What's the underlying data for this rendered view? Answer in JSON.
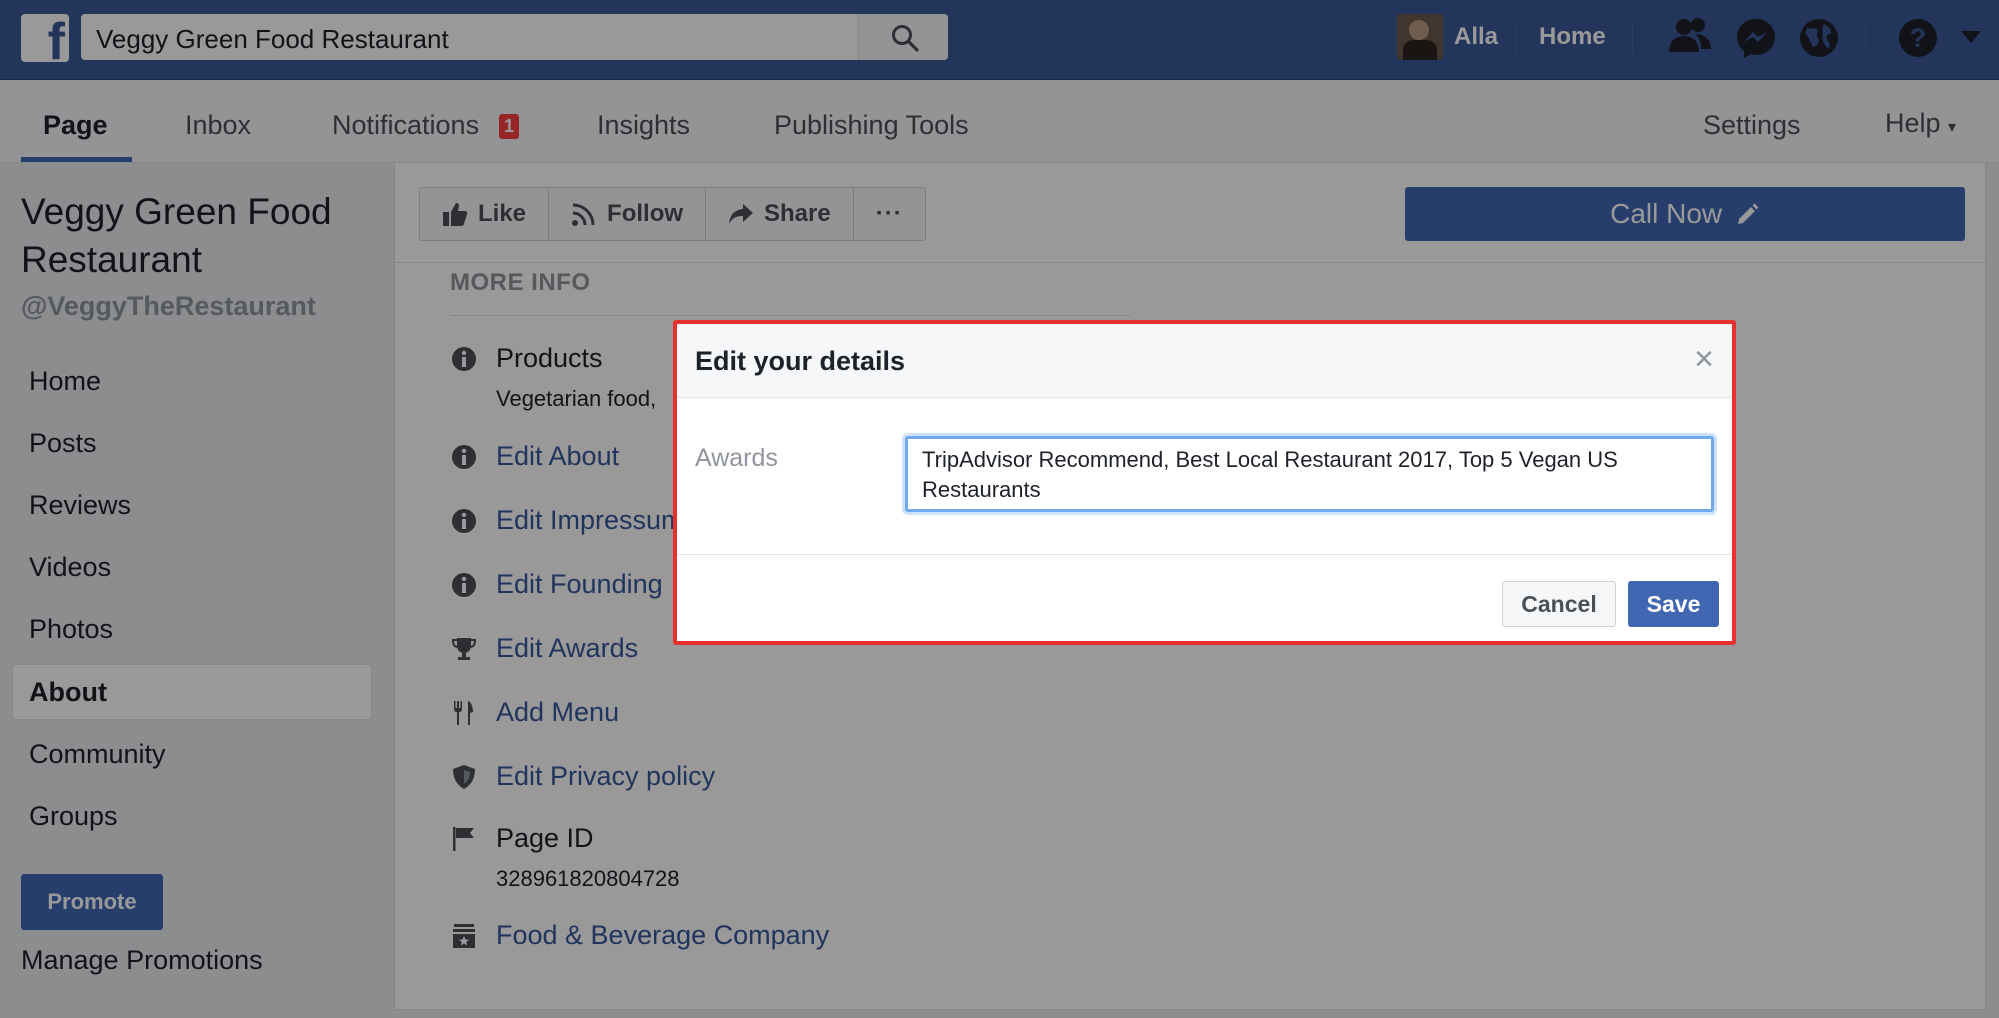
{
  "topbar": {
    "search_value": "Veggy Green Food Restaurant",
    "user_name": "Alla",
    "home_label": "Home"
  },
  "page_nav": {
    "tabs": [
      {
        "label": "Page"
      },
      {
        "label": "Inbox"
      },
      {
        "label": "Notifications"
      },
      {
        "label": "Insights"
      },
      {
        "label": "Publishing Tools"
      }
    ],
    "notifications_count": "1",
    "settings_label": "Settings",
    "help_label": "Help"
  },
  "sidebar": {
    "page_name": "Veggy Green Food Restaurant",
    "handle": "@VeggyTheRestaurant",
    "items": [
      {
        "label": "Home"
      },
      {
        "label": "Posts"
      },
      {
        "label": "Reviews"
      },
      {
        "label": "Videos"
      },
      {
        "label": "Photos"
      },
      {
        "label": "About"
      },
      {
        "label": "Community"
      },
      {
        "label": "Groups"
      }
    ],
    "promote_label": "Promote",
    "manage_promotions_label": "Manage Promotions"
  },
  "actions": {
    "like": "Like",
    "follow": "Follow",
    "share": "Share",
    "more": "···",
    "call_now": "Call Now"
  },
  "about": {
    "section_title": "MORE INFO",
    "products_title": "Products",
    "products_value": "Vegetarian food,",
    "edit_about": "Edit About",
    "edit_impressum": "Edit Impressum",
    "edit_founding": "Edit Founding",
    "edit_awards": "Edit Awards",
    "add_menu": "Add Menu",
    "edit_privacy": "Edit Privacy policy",
    "page_id_title": "Page ID",
    "page_id_value": "328961820804728",
    "category": "Food & Beverage Company"
  },
  "dialog": {
    "title": "Edit your details",
    "close": "×",
    "field_label": "Awards",
    "field_value": "TripAdvisor Recommend, Best Local Restaurant 2017, Top 5 Vegan US Restaurants",
    "cancel_label": "Cancel",
    "save_label": "Save"
  },
  "colors": {
    "brand_blue": "#3b5998",
    "button_blue": "#4267b2",
    "link_blue": "#365899",
    "highlight_red": "#e8302e"
  }
}
